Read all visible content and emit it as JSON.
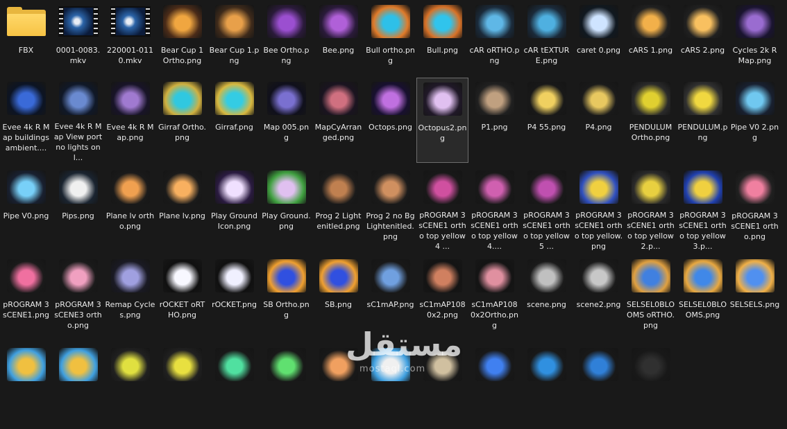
{
  "items": [
    {
      "label": "FBX",
      "kind": "folder"
    },
    {
      "label": "0001-0083.mkv",
      "kind": "video"
    },
    {
      "label": "220001-0110.mkv",
      "kind": "video"
    },
    {
      "label": "Bear Cup 1 Ortho.png",
      "kind": "image",
      "c1": "#f0a640",
      "c2": "#4a2b18"
    },
    {
      "label": "Bear Cup 1.png",
      "kind": "image",
      "c1": "#e8a04a",
      "c2": "#3e2a1a"
    },
    {
      "label": "Bee Ortho.png",
      "kind": "image",
      "c1": "#9b4fd0",
      "c2": "#2a1a3a"
    },
    {
      "label": "Bee.png",
      "kind": "image",
      "c1": "#b060d8",
      "c2": "#2a1a3a"
    },
    {
      "label": "Bull ortho.png",
      "kind": "image",
      "c1": "#2ec0e8",
      "c2": "#e07b2a"
    },
    {
      "label": "Bull.png",
      "kind": "image",
      "c1": "#30c4ec",
      "c2": "#d87228"
    },
    {
      "label": "cAR oRTHO.png",
      "kind": "image",
      "c1": "#5fb7e6",
      "c2": "#1a2a3a"
    },
    {
      "label": "cAR tEXTURE.png",
      "kind": "image",
      "c1": "#4fb0e0",
      "c2": "#1a2a3a"
    },
    {
      "label": "caret 0.png",
      "kind": "image",
      "c1": "#cfe4ff",
      "c2": "#101820"
    },
    {
      "label": "cARS 1.png",
      "kind": "image",
      "c1": "#f2b04a",
      "c2": "#202020"
    },
    {
      "label": "cARS 2.png",
      "kind": "image",
      "c1": "#f8c060",
      "c2": "#202020"
    },
    {
      "label": "Cycles 2k R Map.png",
      "kind": "image",
      "c1": "#9a6cd0",
      "c2": "#1a1430"
    },
    {
      "label": "Evee 4k R Map buildings ambient....",
      "kind": "image",
      "c1": "#3a6ad8",
      "c2": "#0c1424"
    },
    {
      "label": "Evee 4k R Map View port no lights onl...",
      "kind": "image",
      "c1": "#6a8ad0",
      "c2": "#101828"
    },
    {
      "label": "Evee 4k R Map.png",
      "kind": "image",
      "c1": "#a07ad0",
      "c2": "#181428"
    },
    {
      "label": "Girraf Ortho.png",
      "kind": "image",
      "c1": "#30c8e0",
      "c2": "#d0b040"
    },
    {
      "label": "Girraf.png",
      "kind": "image",
      "c1": "#34cce4",
      "c2": "#d8b840"
    },
    {
      "label": "Map 005.png",
      "kind": "image",
      "c1": "#7a70d0",
      "c2": "#10101c"
    },
    {
      "label": "MapCyArranged.png",
      "kind": "image",
      "c1": "#d07080",
      "c2": "#1a1420"
    },
    {
      "label": "Octops.png",
      "kind": "image",
      "c1": "#c070e0",
      "c2": "#181030"
    },
    {
      "label": "Octopus2.png",
      "kind": "image",
      "c1": "#e0c0f0",
      "c2": "#201828"
    },
    {
      "label": "P1.png",
      "kind": "image",
      "c1": "#c0a080",
      "c2": "#202020"
    },
    {
      "label": "P4 55.png",
      "kind": "image",
      "c1": "#f0d060",
      "c2": "#181818"
    },
    {
      "label": "P4.png",
      "kind": "image",
      "c1": "#e8c860",
      "c2": "#1a1a1a"
    },
    {
      "label": "PENDULUM Ortho.png",
      "kind": "image",
      "c1": "#e0d030",
      "c2": "#2a2a2a"
    },
    {
      "label": "PENDULUM.png",
      "kind": "image",
      "c1": "#f0d840",
      "c2": "#303030"
    },
    {
      "label": "Pipe V0 2.png",
      "kind": "image",
      "c1": "#70c8f0",
      "c2": "#182030"
    },
    {
      "label": "Pipe V0.png",
      "kind": "image",
      "c1": "#78d0f8",
      "c2": "#182030"
    },
    {
      "label": "Pips.png",
      "kind": "image",
      "c1": "#f0f0f0",
      "c2": "#1a2430"
    },
    {
      "label": "Plane lv ortho.png",
      "kind": "image",
      "c1": "#f0a050",
      "c2": "#1a1a1a"
    },
    {
      "label": "Plane lv.png",
      "kind": "image",
      "c1": "#f8b060",
      "c2": "#1a1a1a"
    },
    {
      "label": "Play Ground Icon.png",
      "kind": "image",
      "c1": "#f0e0ff",
      "c2": "#2a1a40"
    },
    {
      "label": "Play Ground.png",
      "kind": "image",
      "c1": "#e0c0f0",
      "c2": "#40a040"
    },
    {
      "label": "Prog 2 Lightenitled.png",
      "kind": "image",
      "c1": "#c08050",
      "c2": "#1a1a1a"
    },
    {
      "label": "Prog 2 no Bg Lightenitled.png",
      "kind": "image",
      "c1": "#d09060",
      "c2": "#1a1a1a"
    },
    {
      "label": "pROGRAM 3 sCENE1 ortho top yellow 4 ...",
      "kind": "image",
      "c1": "#d050a0",
      "c2": "#181818"
    },
    {
      "label": "pROGRAM 3 sCENE1 ortho top yellow 4....",
      "kind": "image",
      "c1": "#d060b0",
      "c2": "#181818"
    },
    {
      "label": "pROGRAM 3 sCENE1 ortho top yellow 5 ...",
      "kind": "image",
      "c1": "#c050b0",
      "c2": "#181818"
    },
    {
      "label": "pROGRAM 3 sCENE1 ortho top yellow.png",
      "kind": "image",
      "c1": "#f0d040",
      "c2": "#3050c0"
    },
    {
      "label": "pROGRAM 3 sCENE1 ortho top yellow2.p...",
      "kind": "image",
      "c1": "#e8d040",
      "c2": "#2a2a2a"
    },
    {
      "label": "pROGRAM 3 sCENE1 ortho top yellow3.p...",
      "kind": "image",
      "c1": "#f0d040",
      "c2": "#2040b0"
    },
    {
      "label": "pROGRAM 3 sCENE1 ortho.png",
      "kind": "image",
      "c1": "#f080a0",
      "c2": "#202020"
    },
    {
      "label": "pROGRAM 3 sCENE1.png",
      "kind": "image",
      "c1": "#f070a0",
      "c2": "#1a1a1a"
    },
    {
      "label": "pROGRAM 3 sCENE3 ortho.png",
      "kind": "image",
      "c1": "#f0a0c0",
      "c2": "#1a1a1a"
    },
    {
      "label": "Remap Cycles.png",
      "kind": "image",
      "c1": "#a0a0e0",
      "c2": "#1a1a24"
    },
    {
      "label": "rOCKET oRTHO.png",
      "kind": "image",
      "c1": "#f8f8ff",
      "c2": "#101010"
    },
    {
      "label": "rOCKET.png",
      "kind": "image",
      "c1": "#f0f0ff",
      "c2": "#101010"
    },
    {
      "label": "SB Ortho.png",
      "kind": "image",
      "c1": "#3050e0",
      "c2": "#f0a030"
    },
    {
      "label": "SB.png",
      "kind": "image",
      "c1": "#3050e0",
      "c2": "#f0a030"
    },
    {
      "label": "sC1mAP.png",
      "kind": "image",
      "c1": "#70a0e0",
      "c2": "#181818"
    },
    {
      "label": "sC1mAP1080x2.png",
      "kind": "image",
      "c1": "#d08060",
      "c2": "#141414"
    },
    {
      "label": "sC1mAP1080x2Ortho.png",
      "kind": "image",
      "c1": "#e090a0",
      "c2": "#141414"
    },
    {
      "label": "scene.png",
      "kind": "image",
      "c1": "#c0c0c0",
      "c2": "#1a1a1a"
    },
    {
      "label": "scene2.png",
      "kind": "image",
      "c1": "#c8c8c8",
      "c2": "#1a1a1a"
    },
    {
      "label": "SELSEL0BLOOMS oRTHO.png",
      "kind": "image",
      "c1": "#4080e0",
      "c2": "#e0a040"
    },
    {
      "label": "SELSEL0BLOOMS.png",
      "kind": "image",
      "c1": "#4088e8",
      "c2": "#e8a840"
    },
    {
      "label": "SELSELS.png",
      "kind": "image",
      "c1": "#5090f0",
      "c2": "#f0b048"
    },
    {
      "label": "",
      "kind": "image",
      "c1": "#f0c040",
      "c2": "#40a0e0"
    },
    {
      "label": "",
      "kind": "image",
      "c1": "#f0c040",
      "c2": "#40a0e0"
    },
    {
      "label": "",
      "kind": "image",
      "c1": "#e0e040",
      "c2": "#202020"
    },
    {
      "label": "",
      "kind": "image",
      "c1": "#e8e040",
      "c2": "#202020"
    },
    {
      "label": "",
      "kind": "image",
      "c1": "#50e0a0",
      "c2": "#181818"
    },
    {
      "label": "",
      "kind": "image",
      "c1": "#60e070",
      "c2": "#181818"
    },
    {
      "label": "",
      "kind": "image",
      "c1": "#f0a060",
      "c2": "#181818"
    },
    {
      "label": "",
      "kind": "image",
      "c1": "#f0f0f0",
      "c2": "#40a0e0"
    },
    {
      "label": "",
      "kind": "image",
      "c1": "#d0c0a0",
      "c2": "#181818"
    },
    {
      "label": "",
      "kind": "image",
      "c1": "#4080f0",
      "c2": "#181818"
    },
    {
      "label": "",
      "kind": "image",
      "c1": "#3090e0",
      "c2": "#181818"
    },
    {
      "label": "",
      "kind": "image",
      "c1": "#3080d8",
      "c2": "#181818"
    },
    {
      "label": "",
      "kind": "image",
      "c1": "#303030",
      "c2": "#181818"
    }
  ],
  "selected_label": "Octopus2.png",
  "watermark": {
    "arabic": "مستقل",
    "latin": "mostaql.com"
  }
}
